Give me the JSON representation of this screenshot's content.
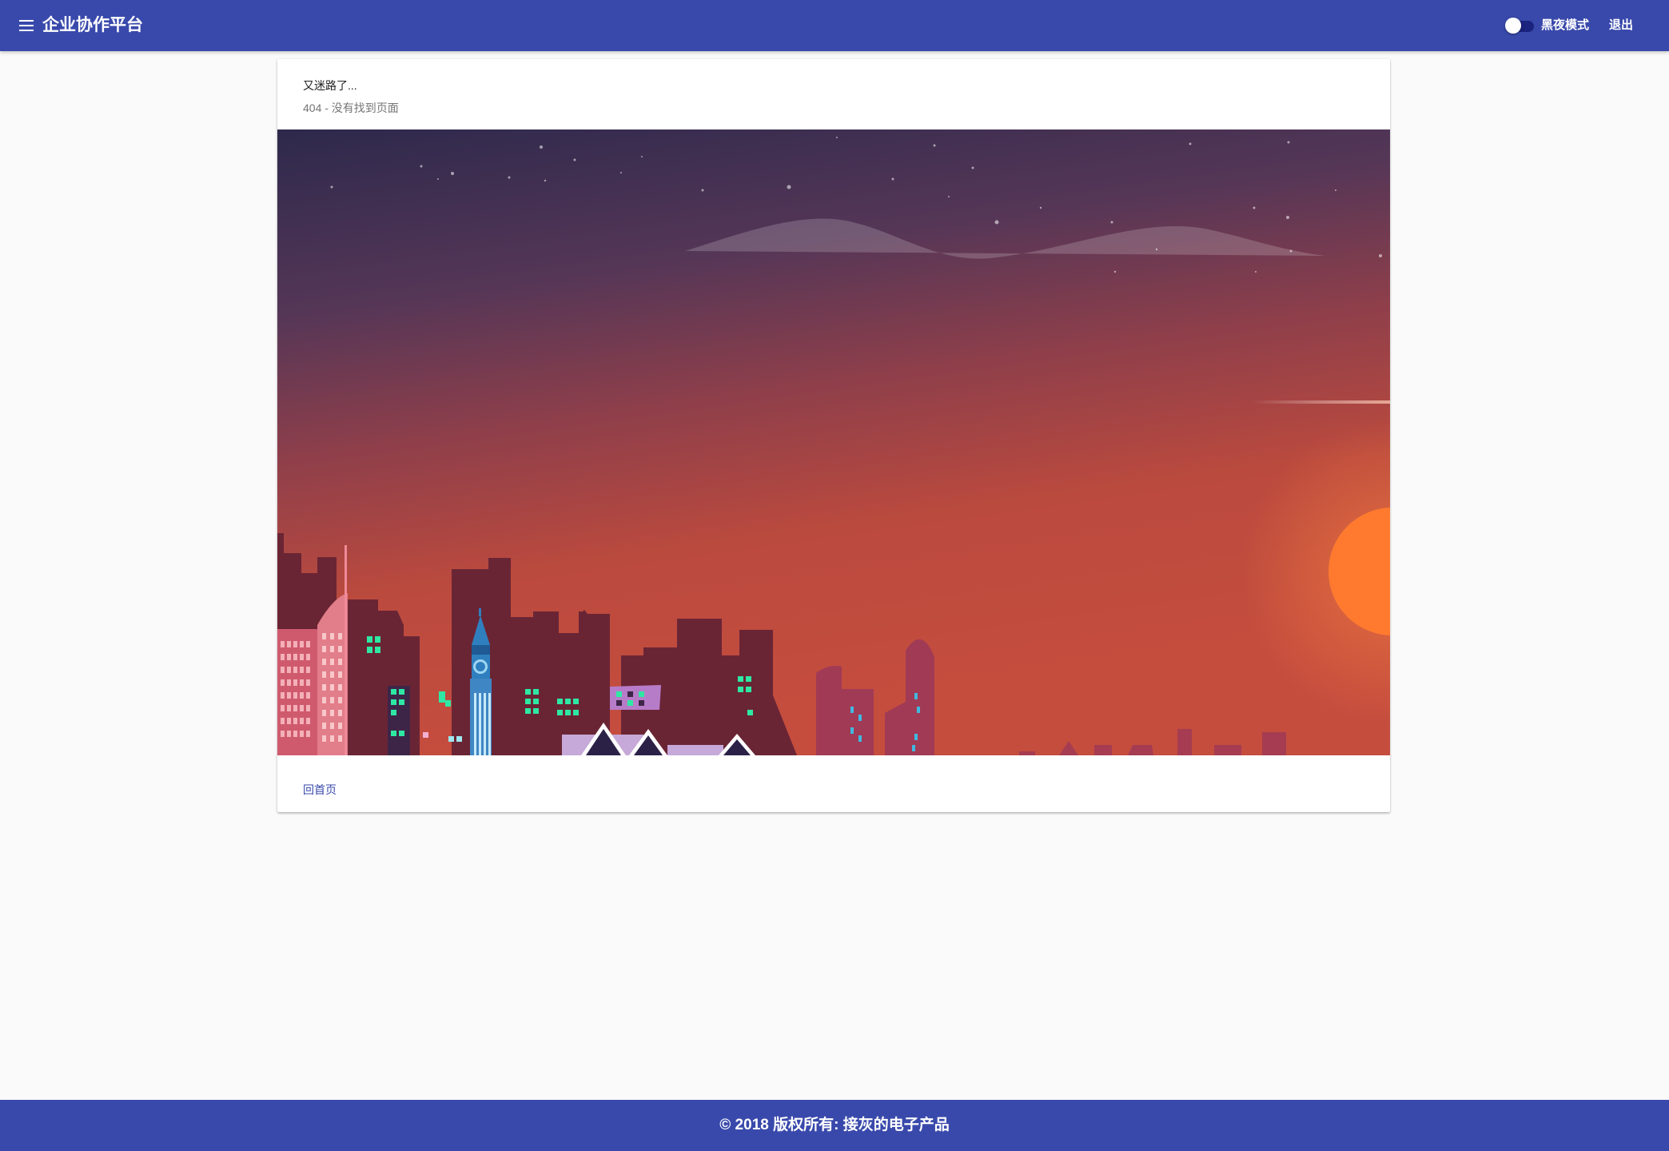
{
  "header": {
    "app_title": "企业协作平台",
    "menu_icon": "menu-icon",
    "dark_mode_label": "黑夜模式",
    "dark_mode_on": false,
    "logout_label": "退出"
  },
  "card": {
    "title": "又迷路了...",
    "subtitle": "404 - 没有找到页面",
    "image_icon": "night-city-illustration",
    "home_label": "回首页"
  },
  "footer": {
    "copyright": "© 2018 版权所有: 接灰的电子产品"
  },
  "colors": {
    "primary": "#3949ab",
    "background": "#fafafa",
    "sky_top": "#2e2a4e",
    "sky_bottom": "#c84b3c",
    "sun": "#ff7a2e",
    "buildings": "#6a2535",
    "windows": "#2ee8a4"
  }
}
